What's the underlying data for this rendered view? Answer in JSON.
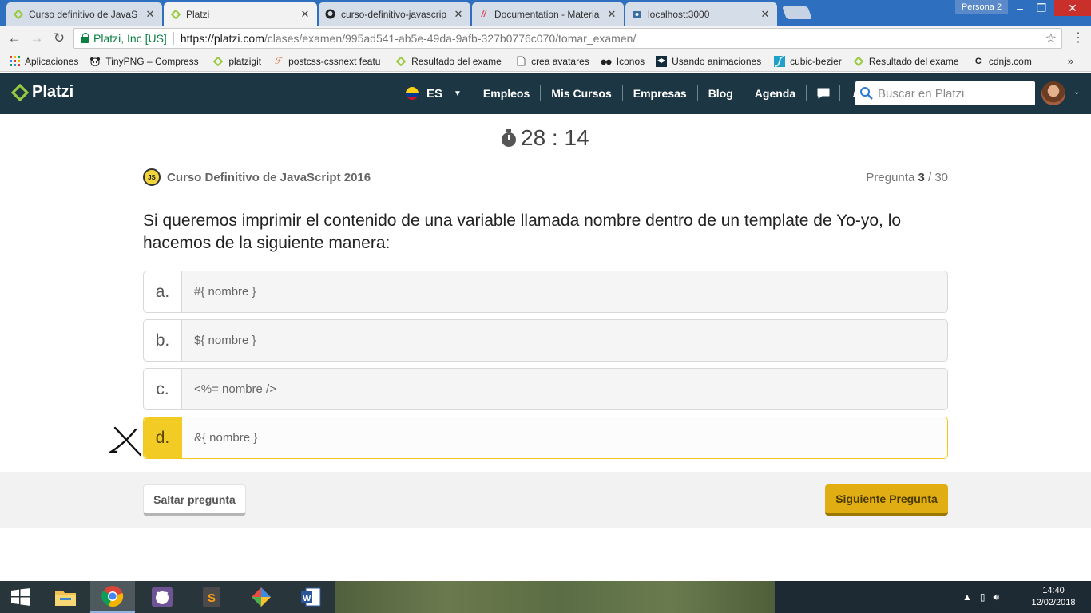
{
  "browser": {
    "tabs": [
      {
        "title": "Curso definitivo de JavaS",
        "close": "✕",
        "icon": "platzi-icon"
      },
      {
        "title": "Platzi",
        "close": "✕",
        "icon": "platzi-icon"
      },
      {
        "title": "curso-definitivo-javascrip",
        "close": "✕",
        "icon": "github-icon"
      },
      {
        "title": "Documentation - Materia",
        "close": "✕",
        "icon": "materialize-icon"
      },
      {
        "title": "localhost:3000",
        "close": "✕",
        "icon": "localhost-icon"
      }
    ],
    "profile": "Persona 2",
    "secure_label": "Platzi, Inc [US]",
    "url_scheme_host": "https://platzi.com",
    "url_path": "/clases/examen/995ad541-ab5e-49da-9afb-327b0776c070/tomar_examen/",
    "bookmarks": [
      {
        "label": "Aplicaciones",
        "icon": "apps-grid-icon"
      },
      {
        "label": "TinyPNG – Compress",
        "icon": "panda-icon"
      },
      {
        "label": "platzigit",
        "icon": "platzi-icon"
      },
      {
        "label": "postcss-cssnext featu",
        "icon": "postcss-icon"
      },
      {
        "label": "Resultado del exame",
        "icon": "platzi-icon"
      },
      {
        "label": "crea avatares",
        "icon": "page-icon"
      },
      {
        "label": "Iconos",
        "icon": "binoculars-icon"
      },
      {
        "label": "Usando animaciones",
        "icon": "cap-icon"
      },
      {
        "label": "cubic-bezier",
        "icon": "curve-icon"
      },
      {
        "label": "Resultado del exame",
        "icon": "platzi-icon"
      },
      {
        "label": "cdnjs.com",
        "icon": "cdnjs-icon"
      }
    ],
    "bookmarks_more": "»"
  },
  "header": {
    "logo": "Platzi",
    "lang": "ES",
    "nav": [
      "Empleos",
      "Mis Cursos",
      "Empresas",
      "Blog",
      "Agenda"
    ],
    "search_placeholder": "Buscar en Platzi"
  },
  "exam": {
    "timer": "28 : 14",
    "course_badge": "JS",
    "course": "Curso Definitivo de JavaScript 2016",
    "question_label": "Pregunta",
    "question_current": "3",
    "question_total": " / 30",
    "question": "Si queremos imprimir el contenido de una variable llamada nombre dentro de un template de Yo-yo, lo hacemos de la siguiente manera:",
    "options": [
      {
        "letter": "a.",
        "text": "#{ nombre }"
      },
      {
        "letter": "b.",
        "text": "${ nombre }"
      },
      {
        "letter": "c.",
        "text": "<%= nombre />"
      },
      {
        "letter": "d.",
        "text": "&{ nombre }"
      }
    ],
    "selected_option": "d.",
    "skip": "Saltar pregunta",
    "next": "Siguiente Pregunta",
    "accent_color": "#f2cc25"
  },
  "taskbar": {
    "time": "14:40",
    "date": "12/02/2018",
    "apps": [
      "file-explorer-icon",
      "chrome-icon",
      "github-desktop-icon",
      "sublime-text-icon",
      "sourcetree-icon",
      "word-icon"
    ]
  }
}
